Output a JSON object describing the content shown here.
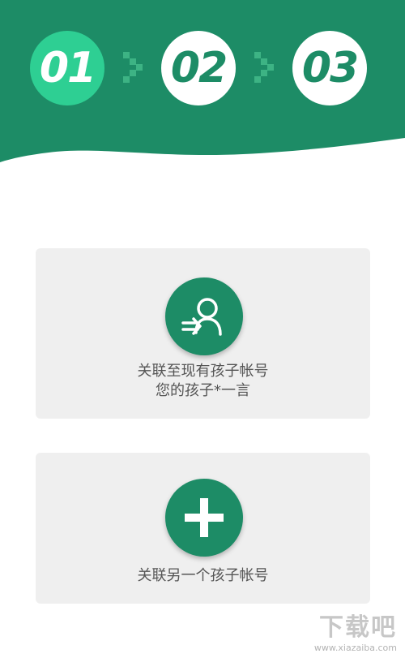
{
  "steps": [
    {
      "label": "01",
      "state": "active"
    },
    {
      "label": "02",
      "state": "inactive"
    },
    {
      "label": "03",
      "state": "inactive"
    }
  ],
  "cards": [
    {
      "icon": "link-user-icon",
      "line1": "关联至现有孩子帐号",
      "line2": "您的孩子*一言"
    },
    {
      "icon": "plus-icon",
      "line1": "关联另一个孩子帐号"
    }
  ],
  "watermark": {
    "logo": "下载吧",
    "url": "www.xiazaiba.com"
  },
  "colors": {
    "primary": "#1d8c66",
    "active": "#2ecf93",
    "card": "#efefef",
    "text": "#555555"
  }
}
